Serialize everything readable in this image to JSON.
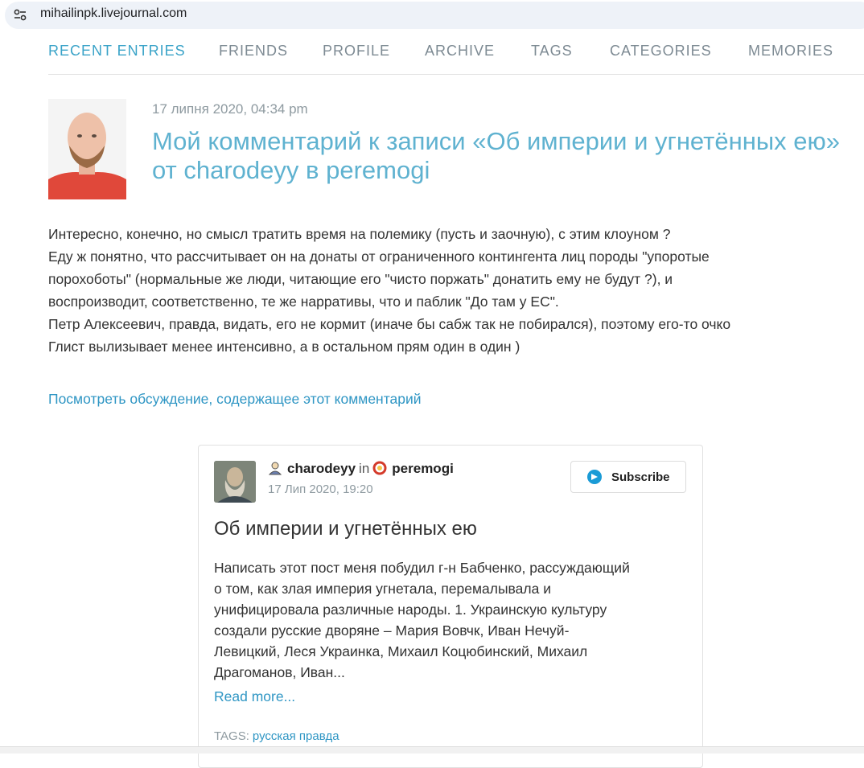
{
  "browser": {
    "url": "mihailinpk.livejournal.com",
    "site_info_icon": "tune-icon"
  },
  "nav": {
    "items": [
      {
        "label": "RECENT ENTRIES",
        "active": true
      },
      {
        "label": "FRIENDS"
      },
      {
        "label": "PROFILE"
      },
      {
        "label": "ARCHIVE"
      },
      {
        "label": "TAGS"
      },
      {
        "label": "CATEGORIES"
      },
      {
        "label": "MEMORIES"
      }
    ]
  },
  "entry": {
    "date": "17 липня 2020, 04:34 pm",
    "title": "Мой комментарий к записи «Об империи и угнетённых ею» от charodeyy в peremogi",
    "body_lines": [
      "Интересно, конечно, но смысл тратить время на полемику (пусть и заочную), с этим клоуном ?",
      "Еду ж понятно, что рассчитывает он на донаты от ограниченного контингента лиц породы \"упоротые",
      "порохоботы\" (нормальные же люди, читающие его \"чисто поржать\" донатить ему не будут ?), и",
      "воспроизводит, соответственно, те же нарративы, что и паблик \"До там у ЕС\".",
      "Петр Алексеевич, правда, видать, его не кормит (иначе бы сабж так не побирался), поэтому его-то очко",
      "Глист вылизывает менее интенсивно, а в остальном прям один в один )"
    ],
    "discussion_link": "Посмотреть обсуждение, содержащее этот комментарий"
  },
  "embed": {
    "author": "charodeyy",
    "in_label": "in",
    "community": "peremogi",
    "date": "17 Лип 2020, 19:20",
    "subscribe_label": "Subscribe",
    "title": "Об империи и угнетённых ею",
    "text_lines": [
      "Написать этот пост меня побудил г-н Бабченко, рассуждающий",
      "о том, как злая империя угнетала, перемалывала и",
      "унифицировала различные народы. 1. Украинскую культуру",
      "создали русские дворяне – Мария Вовчк, Иван Нечуй-",
      "Левицкий, Леся Украинка, Михаил Коцюбинский, Михаил",
      "Драгоманов, Иван..."
    ],
    "read_more": "Read more...",
    "tags_label": "TAGS:",
    "tag": "русская правда"
  },
  "colors": {
    "accent": "#3aa3c8",
    "link": "#2f96c4",
    "title": "#5fb2d0",
    "muted": "#8e9aa0"
  }
}
